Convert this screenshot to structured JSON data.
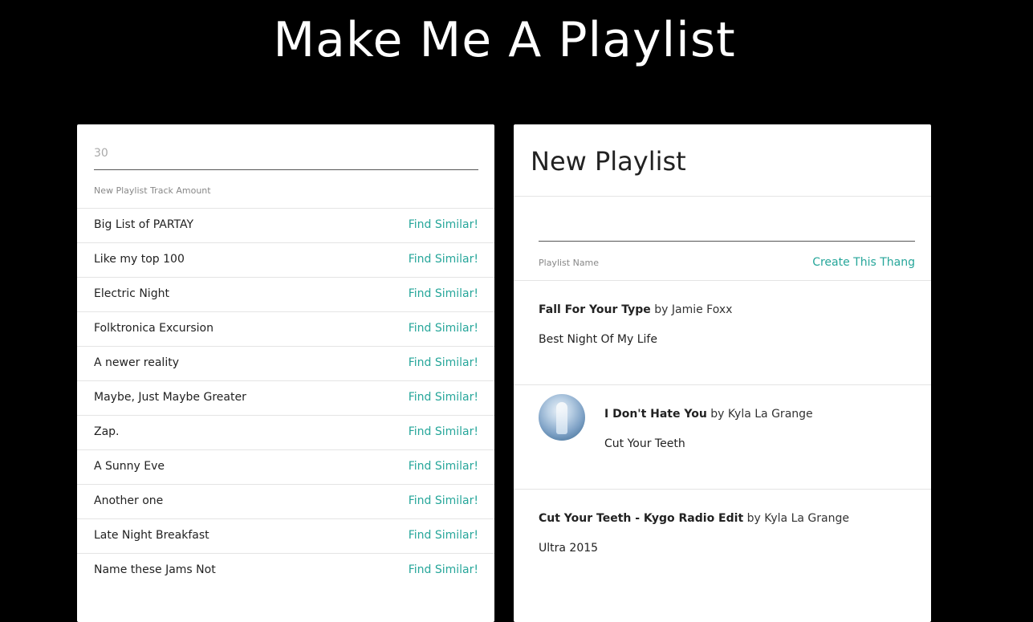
{
  "header": {
    "title": "Make Me A Playlist"
  },
  "left_card": {
    "track_amount_value": "30",
    "track_amount_label": "New Playlist Track Amount",
    "find_label": "Find Similar!",
    "playlists": [
      {
        "name": "Big List of PARTAY"
      },
      {
        "name": "Like my top 100"
      },
      {
        "name": "Electric Night"
      },
      {
        "name": "Folktronica Excursion"
      },
      {
        "name": "A newer reality"
      },
      {
        "name": "Maybe, Just Maybe Greater"
      },
      {
        "name": "Zap."
      },
      {
        "name": "A Sunny Eve"
      },
      {
        "name": "Another one"
      },
      {
        "name": "Late Night Breakfast"
      },
      {
        "name": "Name these Jams Not"
      }
    ]
  },
  "right_card": {
    "title": "New Playlist",
    "playlist_name_value": "",
    "playlist_name_label": "Playlist Name",
    "create_label": "Create This Thang",
    "songs": [
      {
        "title": "Fall For Your Type",
        "by": "by Jamie Foxx",
        "album": "Best Night Of My Life",
        "has_art": false
      },
      {
        "title": "I Don't Hate You",
        "by": "by Kyla La Grange",
        "album": "Cut Your Teeth",
        "has_art": true
      },
      {
        "title": "Cut Your Teeth - Kygo Radio Edit",
        "by": "by Kyla La Grange",
        "album": "Ultra 2015",
        "has_art": false
      }
    ]
  },
  "colors": {
    "background": "#000000",
    "card": "#ffffff",
    "accent": "#26a69a"
  }
}
